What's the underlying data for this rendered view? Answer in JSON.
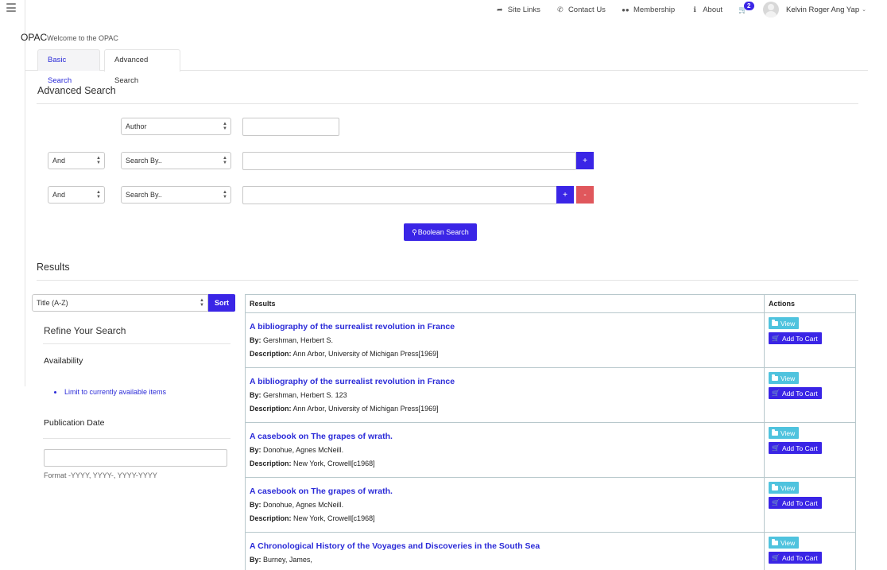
{
  "nav": {
    "links": [
      {
        "label": "Site Links",
        "icon": "share-icon",
        "glyph": "➦"
      },
      {
        "label": "Contact Us",
        "icon": "phone-icon",
        "glyph": "✆"
      },
      {
        "label": "Membership",
        "icon": "users-icon",
        "glyph": "👥"
      },
      {
        "label": "About",
        "icon": "info-icon",
        "glyph": "ℹ"
      }
    ],
    "cart_count": "2",
    "user_name": "Kelvin Roger Ang Yap"
  },
  "header": {
    "title": "OPAC",
    "subtitle": "Welcome to the OPAC"
  },
  "tabs": [
    {
      "label": "Basic Search"
    },
    {
      "label": "Advanced Search"
    }
  ],
  "advanced": {
    "heading": "Advanced Search",
    "rows": [
      {
        "field": "Author",
        "value": ""
      },
      {
        "op": "And",
        "field": "Search By..",
        "value": ""
      },
      {
        "op": "And",
        "field": "Search By..",
        "value": ""
      }
    ],
    "add_label": "+",
    "remove_label": "-",
    "boolean_label": "Boolean Search"
  },
  "results": {
    "heading": "Results",
    "sort_value": "Title (A-Z)",
    "sort_label": "Sort",
    "refine": {
      "title": "Refine Your Search",
      "availability": "Availability",
      "avail_link": "Limit to currently available items",
      "pubdate": "Publication Date",
      "pubdate_value": "",
      "format": "Format -YYYY, YYYY-, YYYY-YYYY"
    },
    "col_results": "Results",
    "col_actions": "Actions",
    "by_label": "By:",
    "desc_label": "Description:",
    "view_label": "View",
    "cart_label": "Add To Cart",
    "items": [
      {
        "title": "A bibliography of the surrealist revolution in France",
        "by": "Gershman, Herbert S.",
        "desc": "Ann Arbor, University of Michigan Press[1969]"
      },
      {
        "title": "A bibliography of the surrealist revolution in France",
        "by": "Gershman, Herbert S. 123",
        "desc": "Ann Arbor, University of Michigan Press[1969]"
      },
      {
        "title": "A casebook on The grapes of wrath.",
        "by": "Donohue, Agnes McNeill.",
        "desc": "New York, Crowell[c1968]"
      },
      {
        "title": "A casebook on The grapes of wrath.",
        "by": "Donohue, Agnes McNeill.",
        "desc": "New York, Crowell[c1968]"
      },
      {
        "title": "A Chronological History of the Voyages and Discoveries in the South Sea",
        "by": "Burney, James,",
        "desc": ""
      }
    ]
  },
  "colors": {
    "primary": "#3a25e6",
    "link": "#2b2bd8",
    "view": "#4fc3de",
    "danger": "#e0575c"
  }
}
